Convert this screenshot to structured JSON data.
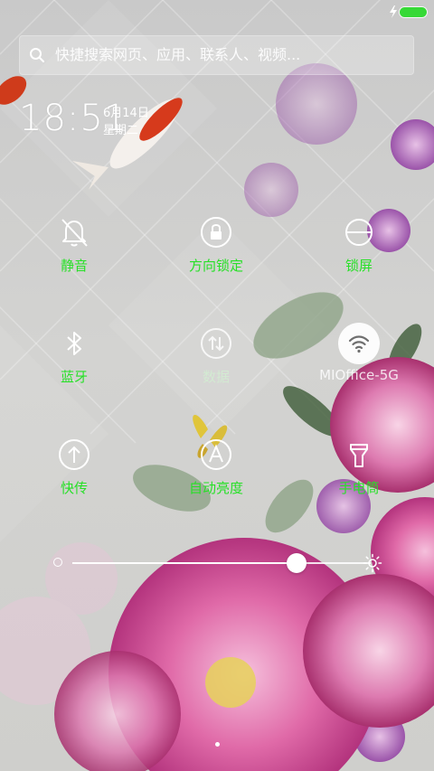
{
  "status_bar": {
    "battery_color": "#36d936"
  },
  "search": {
    "placeholder": "快捷搜索网页、应用、联系人、视频..."
  },
  "clock": {
    "time": "18:51",
    "date": "6月14日",
    "weekday": "星期二"
  },
  "toggles": [
    {
      "label": "静音",
      "icon": "bell-off-icon",
      "state": "on"
    },
    {
      "label": "方向锁定",
      "icon": "rotation-lock-icon",
      "state": "on"
    },
    {
      "label": "锁屏",
      "icon": "lock-icon",
      "state": "on"
    },
    {
      "label": "蓝牙",
      "icon": "bluetooth-icon",
      "state": "on"
    },
    {
      "label": "数据",
      "icon": "mobile-data-icon",
      "state": "disabled"
    },
    {
      "label": "MIOffice-5G",
      "icon": "wifi-icon",
      "state": "connected"
    },
    {
      "label": "快传",
      "icon": "share-upload-icon",
      "state": "on"
    },
    {
      "label": "自动亮度",
      "icon": "auto-brightness-icon",
      "state": "on"
    },
    {
      "label": "手电筒",
      "icon": "flashlight-icon",
      "state": "on"
    }
  ],
  "brightness": {
    "level": 0.75
  },
  "pager": {
    "pages": 1,
    "current": 1
  },
  "colors": {
    "accent_green": "#27e027"
  }
}
